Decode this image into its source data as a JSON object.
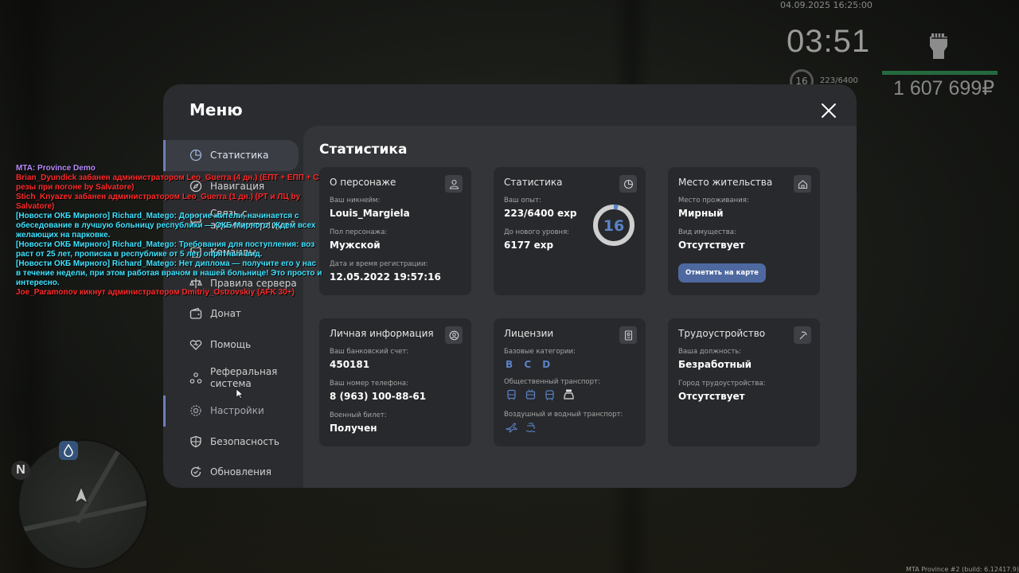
{
  "hud": {
    "datetime": "04.09.2025 16:25:00",
    "clock": "03:51",
    "level": "16",
    "exp": "223/6400",
    "money": "1 607 699₽"
  },
  "chat": [
    {
      "text": "MTA: Province Demo",
      "color": "#b98cff"
    },
    {
      "text": "Brian_Dyundick забанен администратором Leo_Guerra (4 дн.) (ЕПТ + ЕПП + С резы при погоне by Salvatore)",
      "color": "#ff2a2a"
    },
    {
      "text": "Stich_Knyazev забанен администратором Leo_Guerra (1 дн.) (РТ и ЛЦ by Salvatore)",
      "color": "#ff2a2a"
    },
    {
      "text": "[Новости ОКБ Мирного] Richard_Matego: Дорогие жители, начинается с обеседование в лучшую больницу республики — ОКБ Мирного! Ждем всех желающих на парковке.",
      "color": "#3fe3ff"
    },
    {
      "text": "[Новости ОКБ Мирного] Richard_Matego: Требования для поступления: воз раст от 25 лет, прописка в республике от 5 лет, опрятный вид.",
      "color": "#3fe3ff"
    },
    {
      "text": "[Новости ОКБ Мирного] Richard_Matego: Нет диплома — получите его у нас в течение недели, при этом работая врачом в нашей больнице! Это просто и интересно.",
      "color": "#3fe3ff"
    },
    {
      "text": "Joe_Paramonov кикнут администратором Dmitriy_Ostrovskiy (AFK 30+)",
      "color": "#ff2a2a"
    }
  ],
  "menu": {
    "title": "Меню",
    "nav": [
      {
        "label": "Статистика",
        "icon": "chart-pie-icon"
      },
      {
        "label": "Навигация",
        "icon": "compass-icon"
      },
      {
        "label": "Связь с администрацией",
        "icon": "chat-icon"
      },
      {
        "label": "Команды",
        "icon": "command-icon"
      },
      {
        "label": "Правила сервера",
        "icon": "rules-icon"
      },
      {
        "label": "Донат",
        "icon": "wallet-icon"
      },
      {
        "label": "Помощь",
        "icon": "help-heart-icon"
      },
      {
        "label": "Реферальная система",
        "icon": "referral-icon"
      },
      {
        "label": "Настройки",
        "icon": "gear-icon"
      },
      {
        "label": "Безопасность",
        "icon": "shield-icon"
      },
      {
        "label": "Обновления",
        "icon": "update-icon"
      }
    ],
    "content_title": "Статистика",
    "cards": {
      "persona": {
        "title": "О персонаже",
        "nick_label": "Ваш никнейм:",
        "nick": "Louis_Margiela",
        "gender_label": "Пол персонажа:",
        "gender": "Мужской",
        "reg_label": "Дата и время регистрации:",
        "reg": "12.05.2022 19:57:16"
      },
      "stats": {
        "title": "Статистика",
        "exp_label": "Ваш опыт:",
        "exp": "223/6400 exp",
        "next_label": "До нового уровня:",
        "next": "6177 exp",
        "level": "16",
        "progress": 0.035
      },
      "residence": {
        "title": "Место жительства",
        "place_label": "Место проживания:",
        "place": "Мирный",
        "prop_label": "Вид имущества:",
        "prop": "Отсутствует",
        "map_button": "Отметить на карте"
      },
      "personal": {
        "title": "Личная информация",
        "bank_label": "Ваш банковский счет:",
        "bank": "450181",
        "phone_label": "Ваш номер телефона:",
        "phone": "8 (963) 100-88-61",
        "military_label": "Военный билет:",
        "military": "Получен"
      },
      "licenses": {
        "title": "Лицензии",
        "base_label": "Базовые категории:",
        "base": "B C D",
        "public_label": "Общественный транспорт:",
        "air_label": "Воздушный и водный транспорт:"
      },
      "employment": {
        "title": "Трудоустройство",
        "position_label": "Ваша должность:",
        "position": "Безработный",
        "city_label": "Город трудоустройства:",
        "city": "Отсутствует"
      }
    }
  },
  "minimap": {
    "north": "N"
  },
  "build_info": "MTA Province #2 (build: 6.12417.9)"
}
